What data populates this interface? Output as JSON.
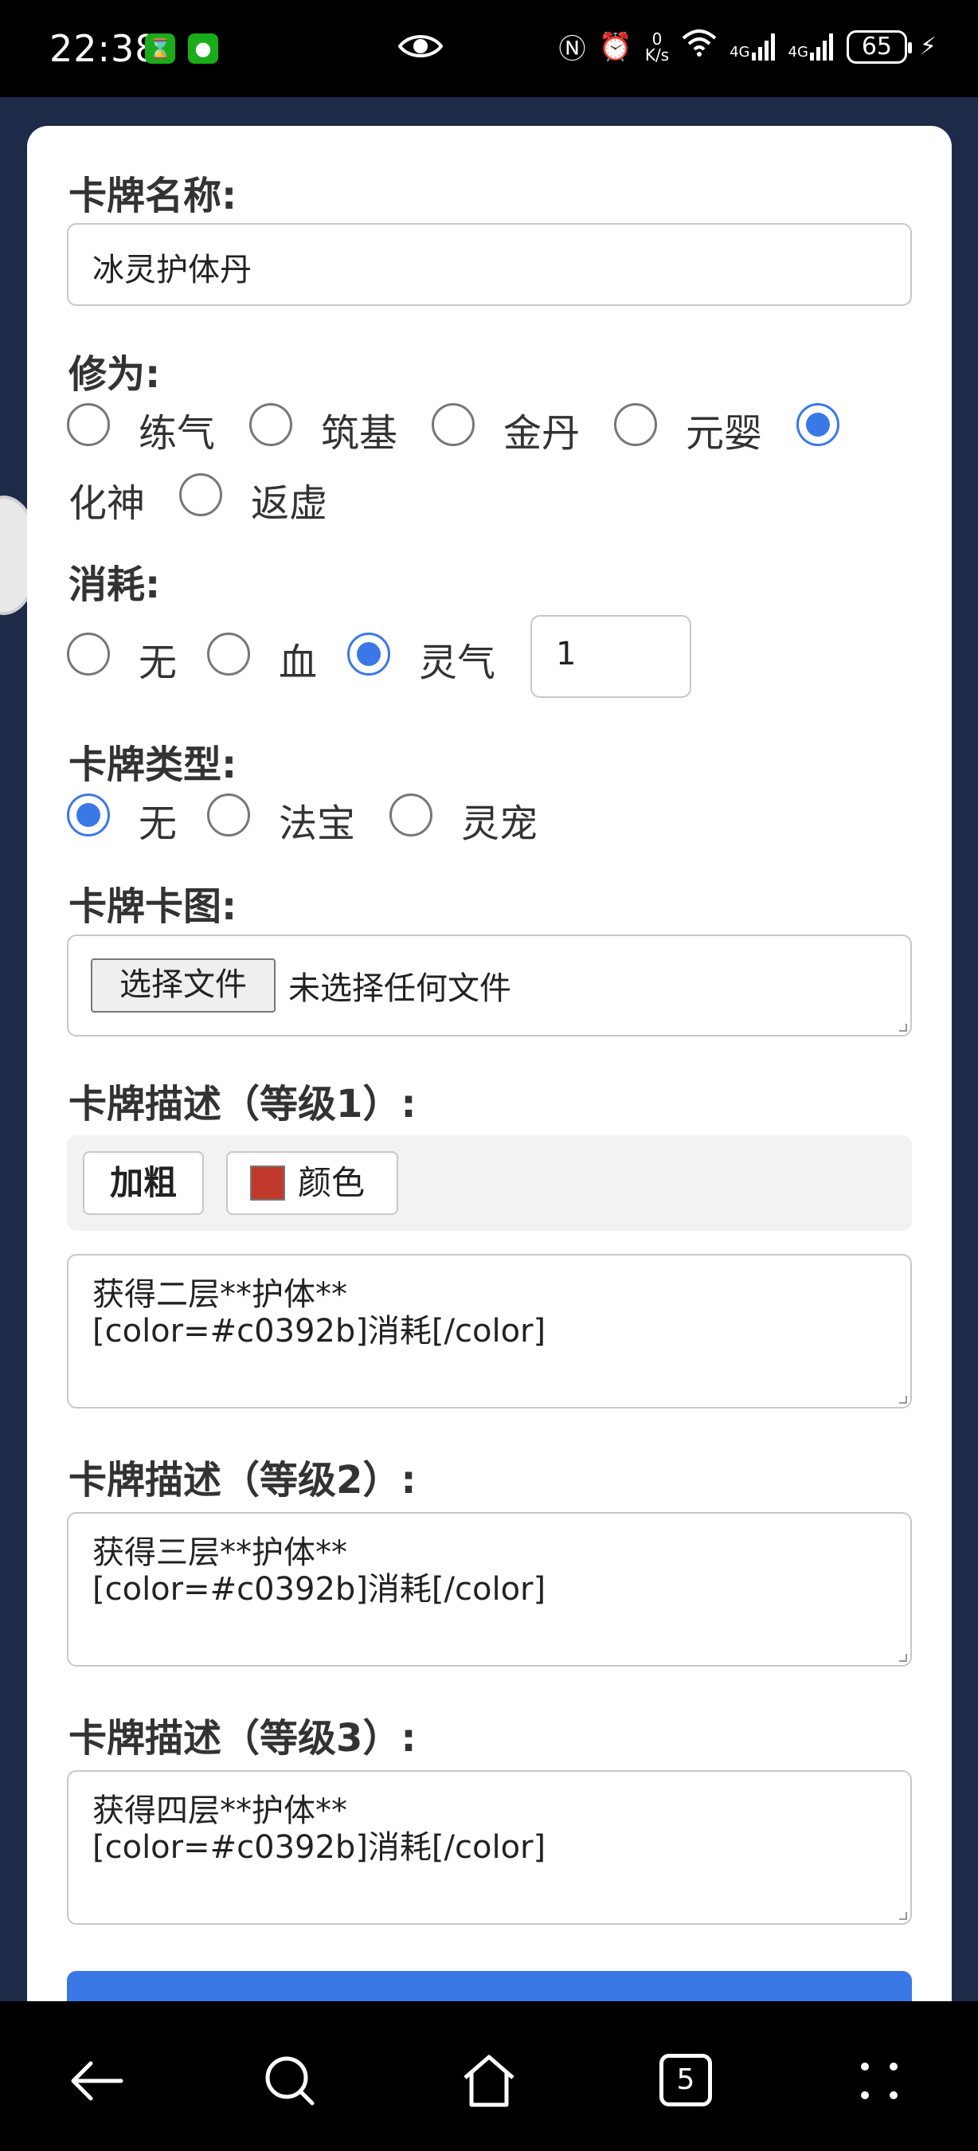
{
  "status_bar": {
    "time": "22:38",
    "net_speed_value": "0",
    "net_speed_unit": "K/s",
    "signal1": "4G",
    "signal2": "4G",
    "battery": "65"
  },
  "form": {
    "name_label": "卡牌名称:",
    "name_value": "冰灵护体丹",
    "realm_label": "修为:",
    "realm_options": [
      "练气",
      "筑基",
      "金丹",
      "元婴",
      "化神",
      "返虚"
    ],
    "realm_selected": "化神",
    "cost_label": "消耗:",
    "cost_options": [
      "无",
      "血",
      "灵气"
    ],
    "cost_selected": "灵气",
    "cost_amount": "1",
    "type_label": "卡牌类型:",
    "type_options": [
      "无",
      "法宝",
      "灵宠"
    ],
    "type_selected": "无",
    "image_label": "卡牌卡图:",
    "file_button": "选择文件",
    "file_status": "未选择任何文件",
    "desc1_label": "卡牌描述（等级1）:",
    "bold_button": "加粗",
    "color_button": "颜色",
    "color_swatch": "#c0392b",
    "desc1_value": "获得二层**护体**\n[color=#c0392b]消耗[/color]",
    "desc2_label": "卡牌描述（等级2）:",
    "desc2_value": "获得三层**护体**\n[color=#c0392b]消耗[/color]",
    "desc3_label": "卡牌描述（等级3）:",
    "desc3_value": "获得四层**护体**\n[color=#c0392b]消耗[/color]"
  },
  "nav": {
    "tabs_count": "5"
  }
}
